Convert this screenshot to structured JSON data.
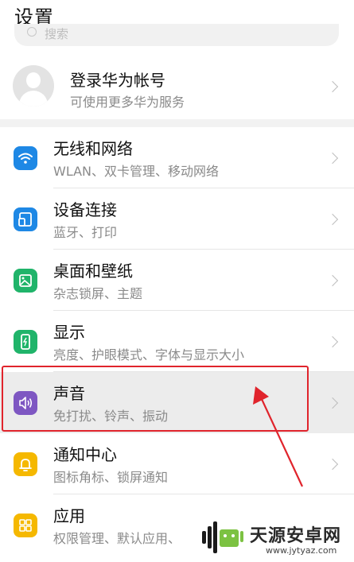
{
  "header": {
    "title": "设置"
  },
  "search": {
    "placeholder": "搜索"
  },
  "account": {
    "title": "登录华为帐号",
    "subtitle": "可使用更多华为服务"
  },
  "settings": [
    {
      "label": "无线和网络",
      "sub": "WLAN、双卡管理、移动网络",
      "icon": "wifi-icon",
      "color": "#1e88e5"
    },
    {
      "label": "设备连接",
      "sub": "蓝牙、打印",
      "icon": "device-connect-icon",
      "color": "#1e88e5"
    },
    {
      "label": "桌面和壁纸",
      "sub": "杂志锁屏、主题",
      "icon": "wallpaper-icon",
      "color": "#20b46a"
    },
    {
      "label": "显示",
      "sub": "亮度、护眼模式、字体与显示大小",
      "icon": "display-icon",
      "color": "#20b46a"
    },
    {
      "label": "声音",
      "sub": "免打扰、铃声、振动",
      "icon": "sound-icon",
      "color": "#7e57c2"
    },
    {
      "label": "通知中心",
      "sub": "图标角标、锁屏通知",
      "icon": "bell-icon",
      "color": "#f5b800"
    },
    {
      "label": "应用",
      "sub": "权限管理、默认应用、",
      "icon": "apps-icon",
      "color": "#f5b800"
    }
  ],
  "watermark": {
    "name": "天源安卓网",
    "url": "www.jytyaz.com"
  }
}
